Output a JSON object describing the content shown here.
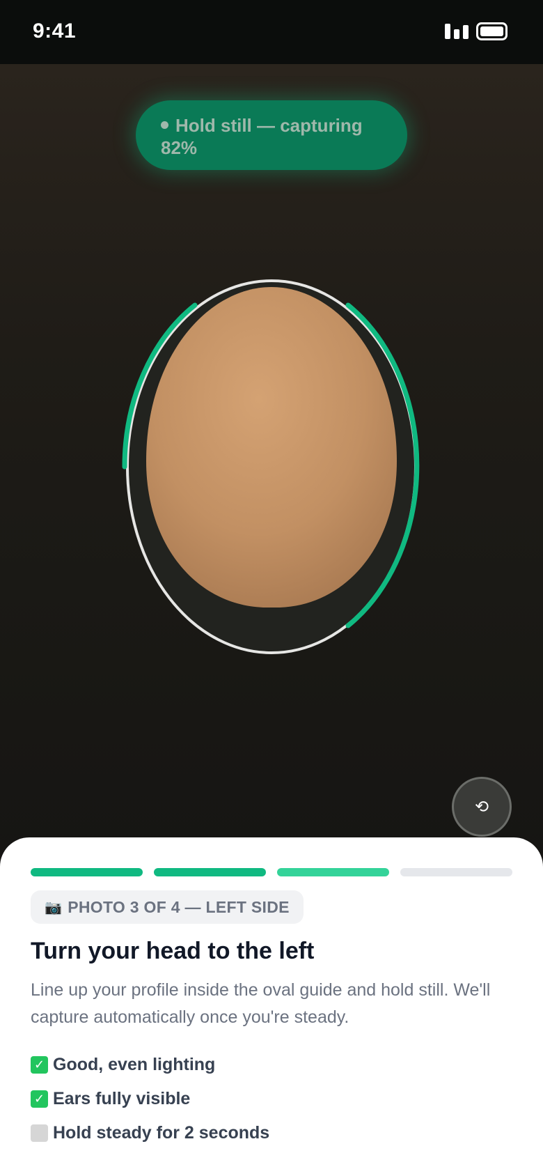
{
  "status_bar": {
    "time": "9:41",
    "icons": [
      "signal-icon",
      "battery-icon"
    ]
  },
  "capture": {
    "status_text": "Hold still — capturing 82%",
    "progress": 0.82,
    "accent_color": "#10b981"
  },
  "camera": {
    "flip_icon": "rotate-camera-icon",
    "flip_glyph": "⟲"
  },
  "progress_steps": [
    {
      "state": "complete",
      "color": "#10b981"
    },
    {
      "state": "complete",
      "color": "#10b981"
    },
    {
      "state": "active",
      "color": "#34d399"
    },
    {
      "state": "pending",
      "color": "#e5e7eb"
    }
  ],
  "sheet": {
    "chip_icon": "📷",
    "chip_label": "PHOTO 3 OF 4 — LEFT SIDE",
    "title": "Turn your head to the left",
    "description": "Line up your profile inside the oval guide and hold still. We'll capture automatically once you're steady.",
    "checklist": [
      {
        "label": "Good, even lighting",
        "done": true
      },
      {
        "label": "Ears fully visible",
        "done": true
      },
      {
        "label": "Hold steady for 2 seconds",
        "done": false
      }
    ]
  }
}
